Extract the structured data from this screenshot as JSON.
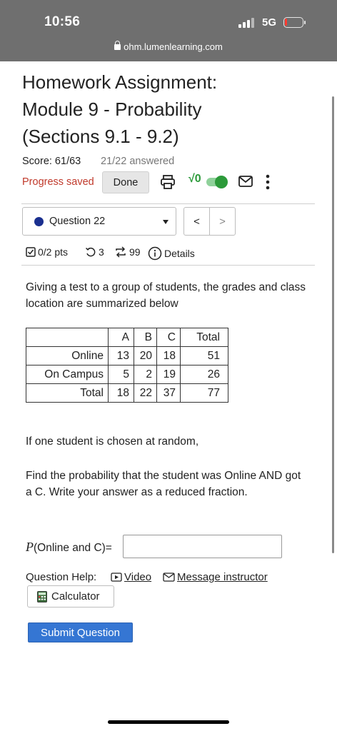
{
  "status_bar": {
    "time": "10:56",
    "network": "5G"
  },
  "browser": {
    "domain": "ohm.lumenlearning.com"
  },
  "assignment": {
    "title_line1": "Homework Assignment:",
    "title_line2": "Module 9 - Probability",
    "title_line3": "(Sections 9.1 - 9.2)",
    "score": "Score: 61/63",
    "answered": "21/22 answered",
    "progress": "Progress saved",
    "done_label": "Done"
  },
  "question_nav": {
    "selected": "Question 22",
    "prev_label": "<",
    "next_label": ">"
  },
  "question_meta": {
    "points": "0/2 pts",
    "retries": "3",
    "attempts": "99",
    "details": "Details"
  },
  "question": {
    "intro": "Giving a test to a group of students, the grades and class location are summarized below",
    "table": {
      "header": [
        "",
        "A",
        "B",
        "C",
        "Total"
      ],
      "rows": [
        [
          "Online",
          "13",
          "20",
          "18",
          "51"
        ],
        [
          "On Campus",
          "5",
          "2",
          "19",
          "26"
        ],
        [
          "Total",
          "18",
          "22",
          "37",
          "77"
        ]
      ]
    },
    "random_text": "If one student is chosen at random,",
    "find_text": "Find the probability that the student was Online AND got a C. Write your answer as a reduced fraction.",
    "answer_func": "P",
    "answer_label": "(Online and C)=",
    "answer_value": ""
  },
  "help": {
    "label": "Question Help:",
    "video": "Video",
    "message": "Message instructor",
    "calculator": "Calculator"
  },
  "submit_label": "Submit Question",
  "colors": {
    "progress_saved": "#c0392b",
    "submit": "#3576d3",
    "toggle": "#2c9a3a",
    "question_dot": "#1a2f8f"
  }
}
